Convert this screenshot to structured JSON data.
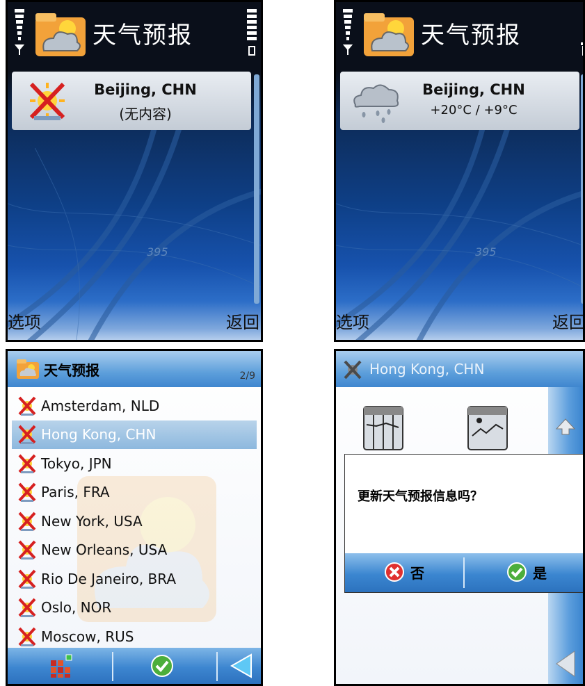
{
  "screen1": {
    "title": "天气预报",
    "card": {
      "city": "Beijing, CHN",
      "status": "(无内容)"
    },
    "softkeys": {
      "left": "选项",
      "right": "返回"
    },
    "road_label": "395"
  },
  "screen2": {
    "title": "天气预报",
    "card": {
      "city": "Beijing, CHN",
      "temps": "+20°C / +9°C"
    },
    "softkeys": {
      "left": "选项",
      "right": "返回"
    },
    "road_label": "395"
  },
  "screen3": {
    "title": "天气预报",
    "counter": "2/9",
    "cities": [
      "Amsterdam, NLD",
      "Hong Kong, CHN",
      "Tokyo, JPN",
      "Paris, FRA",
      "New York, USA",
      "New Orleans, USA",
      "Rio De Janeiro, BRA",
      "Oslo, NOR",
      "Moscow, RUS"
    ],
    "selected_index": 1,
    "toolbar_icons": [
      "apps-icon",
      "check-icon",
      "back-arrow-icon"
    ]
  },
  "screen4": {
    "title": "Hong Kong, CHN",
    "dialog": {
      "message": "更新天气预报信息吗？",
      "no_label": "否",
      "yes_label": "是"
    }
  },
  "colors": {
    "accent_blue": "#3f86cf",
    "selection": "#8db8de",
    "error_red": "#e0302f",
    "ok_green": "#4cae3b"
  }
}
